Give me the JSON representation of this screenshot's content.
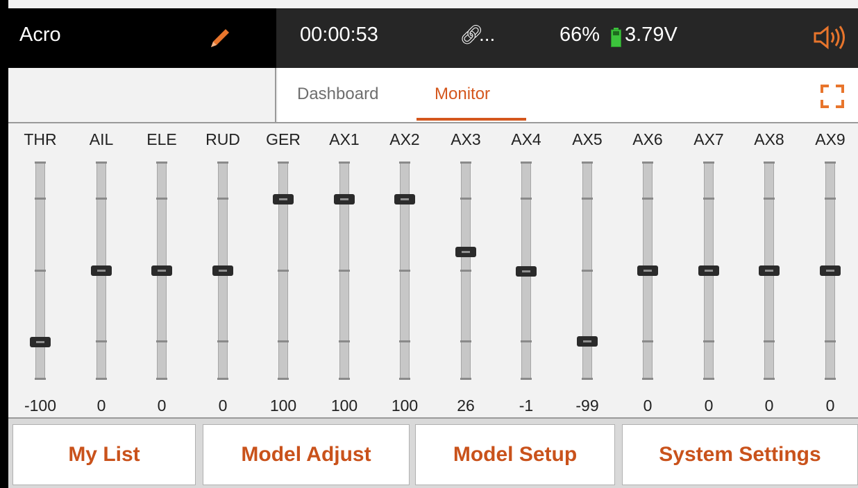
{
  "header": {
    "model_name": "Acro",
    "timer": "00:00:53",
    "link_label": "...",
    "battery_percent": "66%",
    "battery_voltage": "3.79V"
  },
  "tabs": [
    {
      "label": "Dashboard",
      "active": false
    },
    {
      "label": "Monitor",
      "active": true
    }
  ],
  "channels": [
    {
      "name": "THR",
      "value": "-100"
    },
    {
      "name": "AIL",
      "value": "0"
    },
    {
      "name": "ELE",
      "value": "0"
    },
    {
      "name": "RUD",
      "value": "0"
    },
    {
      "name": "GER",
      "value": "100"
    },
    {
      "name": "AX1",
      "value": "100"
    },
    {
      "name": "AX2",
      "value": "100"
    },
    {
      "name": "AX3",
      "value": "26"
    },
    {
      "name": "AX4",
      "value": "-1"
    },
    {
      "name": "AX5",
      "value": "-99"
    },
    {
      "name": "AX6",
      "value": "0"
    },
    {
      "name": "AX7",
      "value": "0"
    },
    {
      "name": "AX8",
      "value": "0"
    },
    {
      "name": "AX9",
      "value": "0"
    }
  ],
  "buttons": {
    "my_list": "My List",
    "model_adjust": "Model Adjust",
    "model_setup": "Model Setup",
    "system_settings": "System Settings"
  },
  "colors": {
    "accent": "#d4571d",
    "battery": "#3cc43c",
    "header_bg": "#000000"
  },
  "icons": {
    "edit": "pencil-icon",
    "link": "link-icon",
    "battery": "battery-icon",
    "speaker": "speaker-icon",
    "expand": "expand-icon"
  }
}
